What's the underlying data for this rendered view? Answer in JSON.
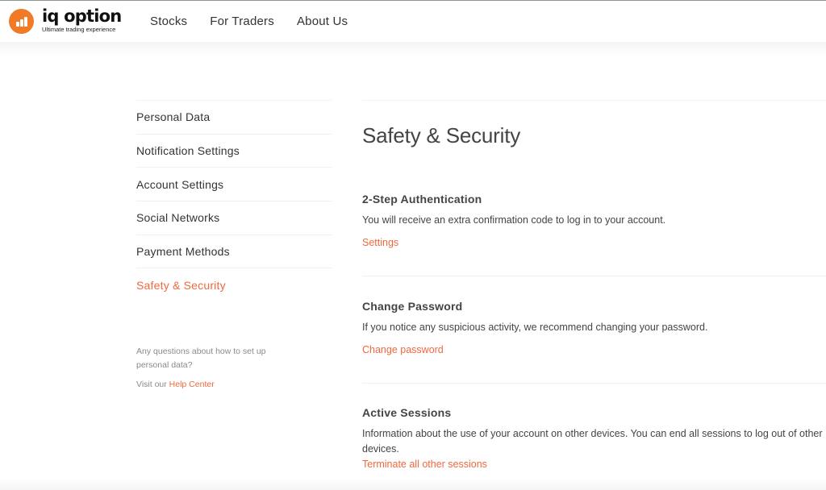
{
  "brand": {
    "name": "iq option",
    "tagline": "Ultimate trading experience",
    "accent_color": "#f0683c",
    "logo_color": "#f07a26"
  },
  "nav": {
    "items": [
      {
        "label": "Stocks"
      },
      {
        "label": "For Traders"
      },
      {
        "label": "About Us"
      }
    ]
  },
  "sidebar": {
    "items": [
      {
        "label": "Personal Data",
        "active": false
      },
      {
        "label": "Notification Settings",
        "active": false
      },
      {
        "label": "Account Settings",
        "active": false
      },
      {
        "label": "Social Networks",
        "active": false
      },
      {
        "label": "Payment Methods",
        "active": false
      },
      {
        "label": "Safety & Security",
        "active": true
      }
    ],
    "help": {
      "question": "Any questions about how to set up personal data?",
      "visit_prefix": "Visit our ",
      "link_label": "Help Center"
    }
  },
  "main": {
    "title": "Safety & Security",
    "sections": [
      {
        "heading": "2-Step Authentication",
        "description": "You will receive an extra confirmation code to log in to your account.",
        "link_label": "Settings"
      },
      {
        "heading": "Change Password",
        "description": "If you notice any suspicious activity, we recommend changing your password.",
        "link_label": "Change password"
      },
      {
        "heading": "Active Sessions",
        "description": "Information about the use of your account on other devices. You can end all sessions to log out of other devices.",
        "link_label": "Terminate all other sessions"
      }
    ]
  }
}
